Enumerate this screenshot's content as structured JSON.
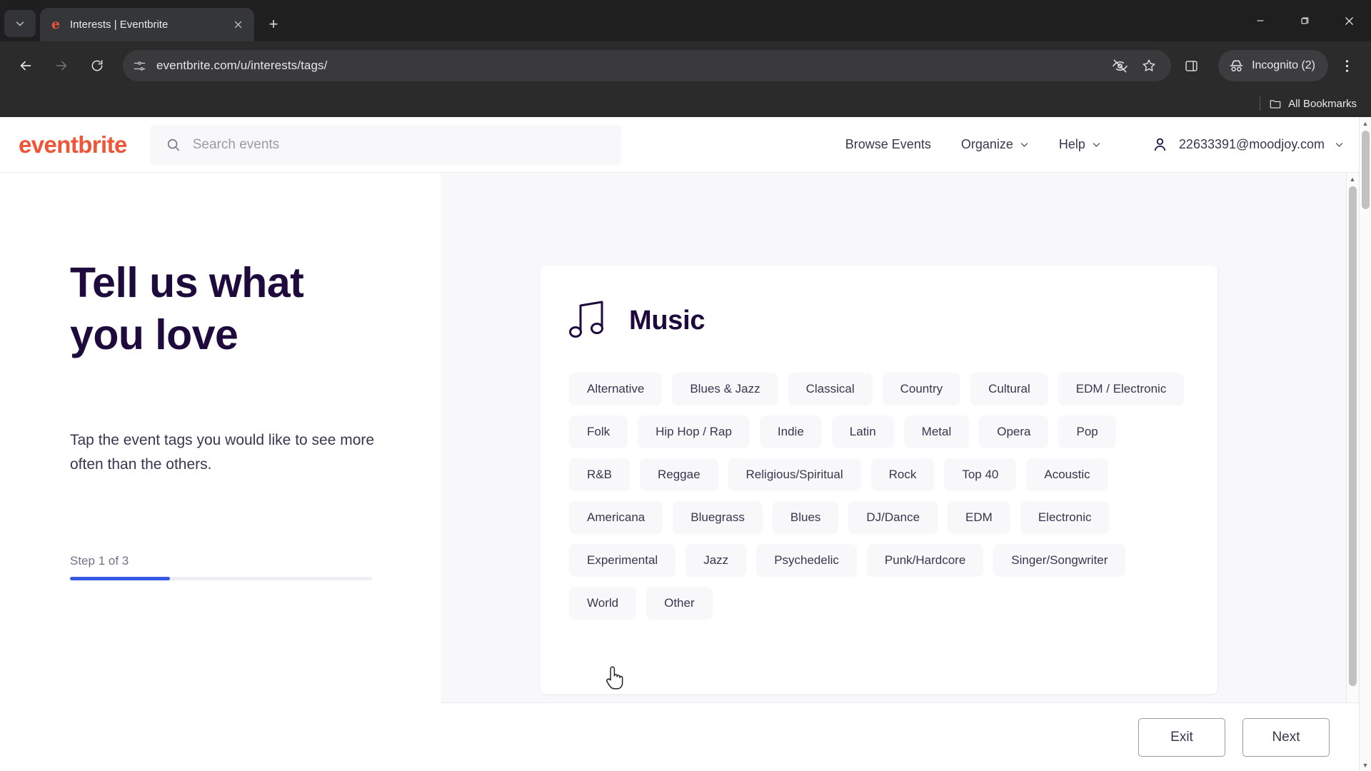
{
  "browser": {
    "tab": {
      "title": "Interests | Eventbrite",
      "favicon_letter": "e",
      "favicon_name": "eventbrite-favicon"
    },
    "newtab_label": "+",
    "url": "eventbrite.com/u/interests/tags/",
    "profile_chip": "Incognito (2)",
    "bookmarks_label": "All Bookmarks",
    "window": {
      "minimize": "—",
      "maximize": "▢",
      "close": "✕"
    },
    "icons": {
      "tab_search": "chevron-down-icon",
      "back": "back-arrow-icon",
      "forward": "forward-arrow-icon",
      "reload": "reload-icon",
      "site_info": "site-settings-icon",
      "tracking": "eye-slash-icon",
      "bookmark": "star-icon",
      "side_panel": "side-panel-icon",
      "incognito": "incognito-hat-icon",
      "menu": "kebab-menu-icon"
    }
  },
  "site": {
    "logo": "eventbrite",
    "search": {
      "placeholder": "Search events",
      "value": ""
    },
    "nav": [
      {
        "label": "Browse Events",
        "caret": false
      },
      {
        "label": "Organize",
        "caret": true
      },
      {
        "label": "Help",
        "caret": true
      }
    ],
    "account": {
      "email": "22633391@moodjoy.com",
      "caret": "⌄"
    }
  },
  "left": {
    "headline_line1": "Tell us what",
    "headline_line2": "you love",
    "subtext": "Tap the event tags you would like to see more often than the others.",
    "step_label": "Step 1 of 3",
    "progress_percent": 33
  },
  "card": {
    "icon": "music-note-icon",
    "title": "Music",
    "tag_rows": [
      [
        "Alternative",
        "Blues & Jazz",
        "Classical",
        "Country",
        "Cultural",
        "EDM / Electronic"
      ],
      [
        "Folk",
        "Hip Hop / Rap",
        "Indie",
        "Latin",
        "Metal",
        "Opera",
        "Pop"
      ],
      [
        "R&B",
        "Reggae",
        "Religious/Spiritual",
        "Rock",
        "Top 40",
        "Acoustic"
      ],
      [
        "Americana",
        "Bluegrass",
        "Blues",
        "DJ/Dance",
        "EDM",
        "Electronic"
      ],
      [
        "Experimental",
        "Jazz",
        "Psychedelic",
        "Punk/Hardcore",
        "Singer/Songwriter"
      ],
      [
        "World",
        "Other"
      ]
    ]
  },
  "footer": {
    "exit_label": "Exit",
    "next_label": "Next"
  },
  "colors": {
    "brand_orange": "#F05537",
    "heading_navy": "#1E0A3C",
    "body_text": "#39364F",
    "progress_blue": "#3659E3",
    "tag_bg": "#F8F7FA"
  }
}
